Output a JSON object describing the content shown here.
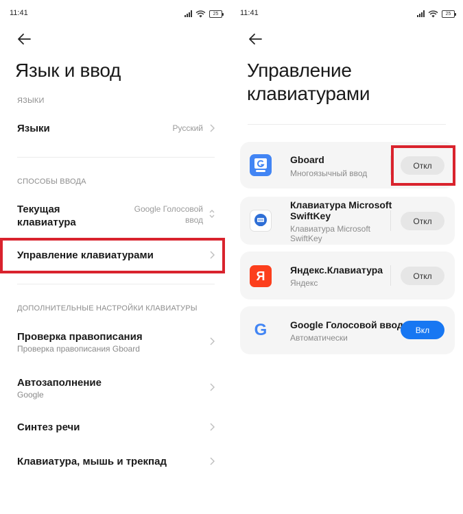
{
  "status_bar": {
    "time": "11:41",
    "battery": "25"
  },
  "left": {
    "title": "Язык и ввод",
    "section_languages": "ЯЗЫКИ",
    "languages": {
      "title": "Языки",
      "value": "Русский"
    },
    "section_input": "СПОСОБЫ ВВОДА",
    "current_keyboard": {
      "title_line1": "Текущая",
      "title_line2": "клавиатура",
      "value_line1": "Google Голосовой",
      "value_line2": "ввод"
    },
    "manage_keyboards": {
      "title": "Управление клавиатурами"
    },
    "section_extra": "ДОПОЛНИТЕЛЬНЫЕ НАСТРОЙКИ КЛАВИАТУРЫ",
    "spellcheck": {
      "title": "Проверка правописания",
      "subtitle": "Проверка правописания Gboard"
    },
    "autofill": {
      "title": "Автозаполнение",
      "subtitle": "Google"
    },
    "tts": {
      "title": "Синтез речи"
    },
    "keyboard_mouse": {
      "title": "Клавиатура, мышь и трекпад"
    }
  },
  "right": {
    "title_line1": "Управление",
    "title_line2": "клавиатурами",
    "keyboards": [
      {
        "name": "Gboard",
        "desc": "Многоязычный ввод",
        "toggle": "Откл",
        "enabled": false
      },
      {
        "name_line1": "Клавиатура Microsoft",
        "name_line2": "SwiftKey",
        "desc_line1": "Клавиатура Microsoft",
        "desc_line2": "SwiftKey",
        "toggle": "Откл",
        "enabled": false
      },
      {
        "name": "Яндекс.Клавиатура",
        "desc": "Яндекс",
        "toggle": "Откл",
        "enabled": false,
        "icon_letter": "Я"
      },
      {
        "name": "Google Голосовой ввод",
        "desc": "Автоматически",
        "toggle": "Вкл",
        "enabled": true,
        "icon_letter": "G"
      }
    ]
  },
  "colors": {
    "accent": "#1877f2",
    "highlight": "#d9232d",
    "card_bg": "#f5f5f5",
    "gboard_blue": "#4285f4",
    "yandex_red": "#fc3f1d"
  },
  "icons": [
    "signal-icon",
    "wifi-icon",
    "battery-icon",
    "back-arrow-icon",
    "chevron-right-icon",
    "chevron-updown-icon",
    "gboard-icon",
    "swiftkey-icon",
    "yandex-icon",
    "google-icon"
  ]
}
